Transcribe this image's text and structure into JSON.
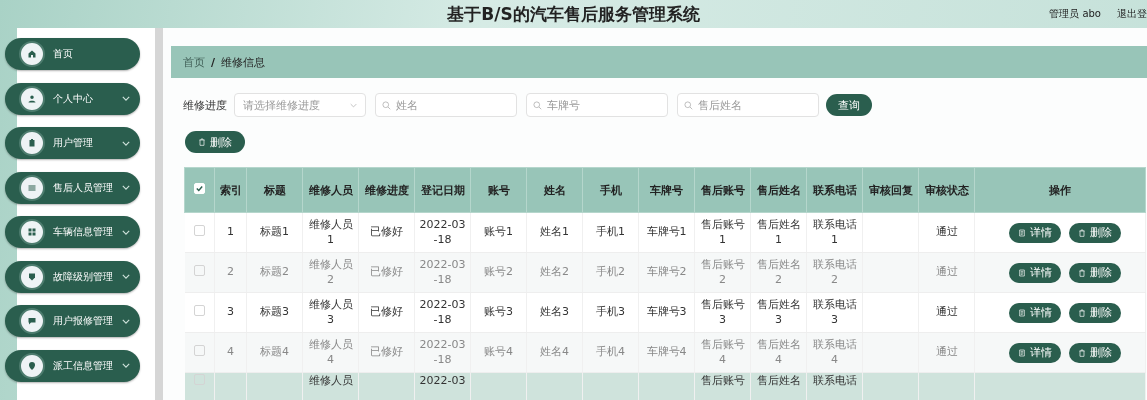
{
  "header": {
    "title": "基于B/S的汽车售后服务管理系统",
    "user": "管理员 abo",
    "logout": "退出登"
  },
  "sidebar": {
    "items": [
      {
        "label": "首页",
        "has_submenu": false
      },
      {
        "label": "个人中心",
        "has_submenu": true
      },
      {
        "label": "用户管理",
        "has_submenu": true
      },
      {
        "label": "售后人员管理",
        "has_submenu": true
      },
      {
        "label": "车辆信息管理",
        "has_submenu": true
      },
      {
        "label": "故障级别管理",
        "has_submenu": true
      },
      {
        "label": "用户报修管理",
        "has_submenu": true
      },
      {
        "label": "派工信息管理",
        "has_submenu": true
      }
    ]
  },
  "breadcrumb": [
    "首页",
    "维修信息"
  ],
  "breadcrumb_separator": "/",
  "filters": {
    "select_label": "维修进度",
    "select_placeholder": "请选择维修进度",
    "inputs": [
      {
        "placeholder": "姓名"
      },
      {
        "placeholder": "车牌号"
      },
      {
        "placeholder": "售后姓名"
      }
    ],
    "search_button": "查询"
  },
  "delete_button": "删除",
  "table": {
    "header_checked": true,
    "columns": [
      "索引",
      "标题",
      "维修人员",
      "维修进度",
      "登记日期",
      "账号",
      "姓名",
      "手机",
      "车牌号",
      "售后账号",
      "售后姓名",
      "联系电话",
      "审核回复",
      "审核状态",
      "操作"
    ],
    "rows": [
      {
        "checked": false,
        "highlighted": false,
        "cells": [
          "1",
          "标题1",
          "维修人员1",
          "已修好",
          "2022-03-18",
          "账号1",
          "姓名1",
          "手机1",
          "车牌号1",
          "售后账号1",
          "售后姓名1",
          "联系电话1",
          null,
          "通过"
        ],
        "actions": [
          "详情",
          "删除"
        ]
      },
      {
        "checked": false,
        "highlighted": false,
        "cells": [
          "2",
          "标题2",
          "维修人员2",
          "已修好",
          "2022-03-18",
          "账号2",
          "姓名2",
          "手机2",
          "车牌号2",
          "售后账号2",
          "售后姓名2",
          "联系电话2",
          null,
          "通过"
        ],
        "actions": [
          "详情",
          "删除"
        ]
      },
      {
        "checked": false,
        "highlighted": false,
        "cells": [
          "3",
          "标题3",
          "维修人员3",
          "已修好",
          "2022-03-18",
          "账号3",
          "姓名3",
          "手机3",
          "车牌号3",
          "售后账号3",
          "售后姓名3",
          "联系电话3",
          null,
          "通过"
        ],
        "actions": [
          "详情",
          "删除"
        ]
      },
      {
        "checked": false,
        "highlighted": false,
        "cells": [
          "4",
          "标题4",
          "维修人员4",
          "已修好",
          "2022-03-18",
          "账号4",
          "姓名4",
          "手机4",
          "车牌号4",
          "售后账号4",
          "售后姓名4",
          "联系电话4",
          null,
          "通过"
        ],
        "actions": [
          "详情",
          "删除"
        ]
      },
      {
        "checked": false,
        "highlighted": true,
        "cells": [
          null,
          null,
          "维修人员",
          null,
          "2022-03",
          null,
          null,
          null,
          null,
          "售后账号",
          "售后姓名",
          "联系电话",
          null,
          null
        ],
        "actions": []
      }
    ]
  }
}
